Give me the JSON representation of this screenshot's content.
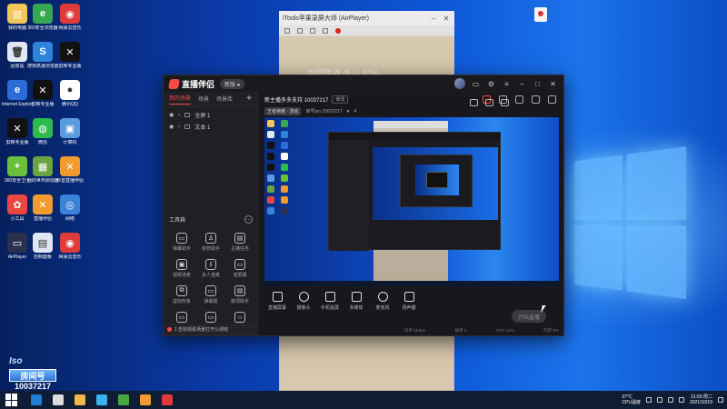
{
  "airplayer": {
    "title": "iTools苹果录屏大师 (AirPlayer)",
    "phone_status": "‹  中国联通  令    ◎ 97%"
  },
  "app": {
    "logo": "直播伴侣",
    "version": "新版 ●",
    "tabs": [
      "我的场景",
      "场景",
      "场景库"
    ],
    "add_label": "+",
    "scenes": [
      "全屏 1",
      "文本 1"
    ],
    "tools_title": "工具箱",
    "tools": [
      {
        "label": "弹幕助手",
        "icon": "▭"
      },
      {
        "label": "房管助手",
        "icon": "♙"
      },
      {
        "label": "主播任务",
        "icon": "▤"
      },
      {
        "label": "视频连麦",
        "icon": "▣"
      },
      {
        "label": "多人连麦",
        "icon": "⇩"
      },
      {
        "label": "连屏幕",
        "icon": "▭"
      },
      {
        "label": "虚拟形象",
        "icon": "⧉"
      },
      {
        "label": "弹幕姬",
        "icon": "▭"
      },
      {
        "label": "歌词助手",
        "icon": "▤"
      },
      {
        "label": "",
        "icon": "▭"
      },
      {
        "label": "",
        "icon": "▭"
      },
      {
        "label": "",
        "icon": "⌂"
      }
    ],
    "notice": "1.告别观看场景打开公测班",
    "room_title": "新主播多多支持 10037217",
    "edit_label": "修改",
    "category": "王者荣耀 · 游戏",
    "room_meta": "房号isn   10037217",
    "likes": "4",
    "controls": [
      {
        "label": "直播屏幕",
        "round": false
      },
      {
        "label": "摄像头",
        "round": true
      },
      {
        "label": "手机投屏",
        "round": false
      },
      {
        "label": "多媒体",
        "round": false
      },
      {
        "label": "麦克风",
        "round": true
      },
      {
        "label": "扬声器",
        "round": false
      }
    ],
    "start_button": "开始直播",
    "status": [
      "码率 0Kbps",
      "帧率 0",
      "CPU 14%",
      "内存 9%"
    ]
  },
  "desktop": {
    "icons": [
      {
        "label": "我的电脑",
        "color": "#f1c75b",
        "glyph": "▥"
      },
      {
        "label": "360安全浏览器",
        "color": "#36a852",
        "glyph": "e"
      },
      {
        "label": "网易云音乐",
        "color": "#e03b3b",
        "glyph": "◉"
      },
      {
        "label": "回收站",
        "color": "#dfe8f4",
        "glyph": "🗑"
      },
      {
        "label": "搜狗高速浏览器",
        "color": "#2d84d8",
        "glyph": "S"
      },
      {
        "label": "剪映专业版",
        "color": "#111111",
        "glyph": "✕"
      },
      {
        "label": "Internet Explorer",
        "color": "#2b6cd8",
        "glyph": "e"
      },
      {
        "label": "剪映专业版",
        "color": "#111111",
        "glyph": "✕"
      },
      {
        "label": "腾讯QQ",
        "color": "#ffffff",
        "glyph": "●"
      },
      {
        "label": "剪映专业版",
        "color": "#111111",
        "glyph": "✕"
      },
      {
        "label": "微信",
        "color": "#2dbb4d",
        "glyph": "◍"
      },
      {
        "label": "计算机",
        "color": "#5a9be0",
        "glyph": "▣"
      },
      {
        "label": "360安全卫士",
        "color": "#6abf3b",
        "glyph": "+"
      },
      {
        "label": "我的世界启动器",
        "color": "#6aa341",
        "glyph": "▦"
      },
      {
        "label": "抖音直播伴侣",
        "color": "#f29a2e",
        "glyph": "✕"
      },
      {
        "label": "小工具",
        "color": "#e9473f",
        "glyph": "✿"
      },
      {
        "label": "直播伴侣",
        "color": "#f29a2e",
        "glyph": "✕"
      },
      {
        "label": "网络",
        "color": "#3b82d9",
        "glyph": "◎"
      },
      {
        "label": "AirPlayer",
        "color": "#2a3050",
        "glyph": "▭"
      },
      {
        "label": "控制面板",
        "color": "#dde6f2",
        "glyph": "▤"
      },
      {
        "label": "网易云音乐",
        "color": "#e03b3b",
        "glyph": "◉"
      }
    ],
    "badge_top": "Iso",
    "badge_mid": "房间号",
    "badge_num": "10037217"
  },
  "taskbar": {
    "apps": [
      "#1e7fd8",
      "#dddddd",
      "#f0b84a",
      "#3bb3f0",
      "#46a843",
      "#f29a2e",
      "#e03b3b"
    ],
    "weather_temp": "37°C",
    "weather_desc": "CPU温度",
    "time": "21:59 周二",
    "date": "2021/10/19"
  }
}
